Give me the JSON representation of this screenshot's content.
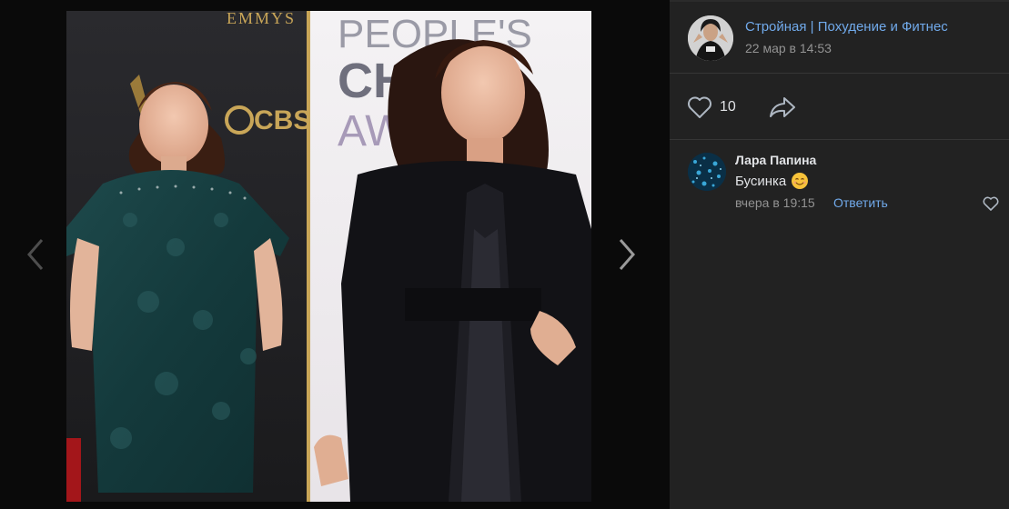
{
  "post": {
    "author_name": "Стройная | Похудение и Фитнес",
    "date": "22 мар в 14:53",
    "likes_count": "10",
    "like_icon": "heart-outline-icon",
    "share_icon": "share-arrow-icon"
  },
  "photo": {
    "backdrop_left_text": "EMMYS",
    "backdrop_left_logo": "CBS",
    "backdrop_right_lines": [
      "PEOPLE'S",
      "CH",
      "AW"
    ]
  },
  "comments": [
    {
      "author": "Лара Папина",
      "text": "Бусинка",
      "emoji": "smiling-face-emoji",
      "date": "вчера в 19:15",
      "reply_label": "Ответить"
    }
  ],
  "colors": {
    "link": "#71aaeb",
    "panel_bg": "#222222",
    "viewer_bg": "#0a0a0a"
  }
}
